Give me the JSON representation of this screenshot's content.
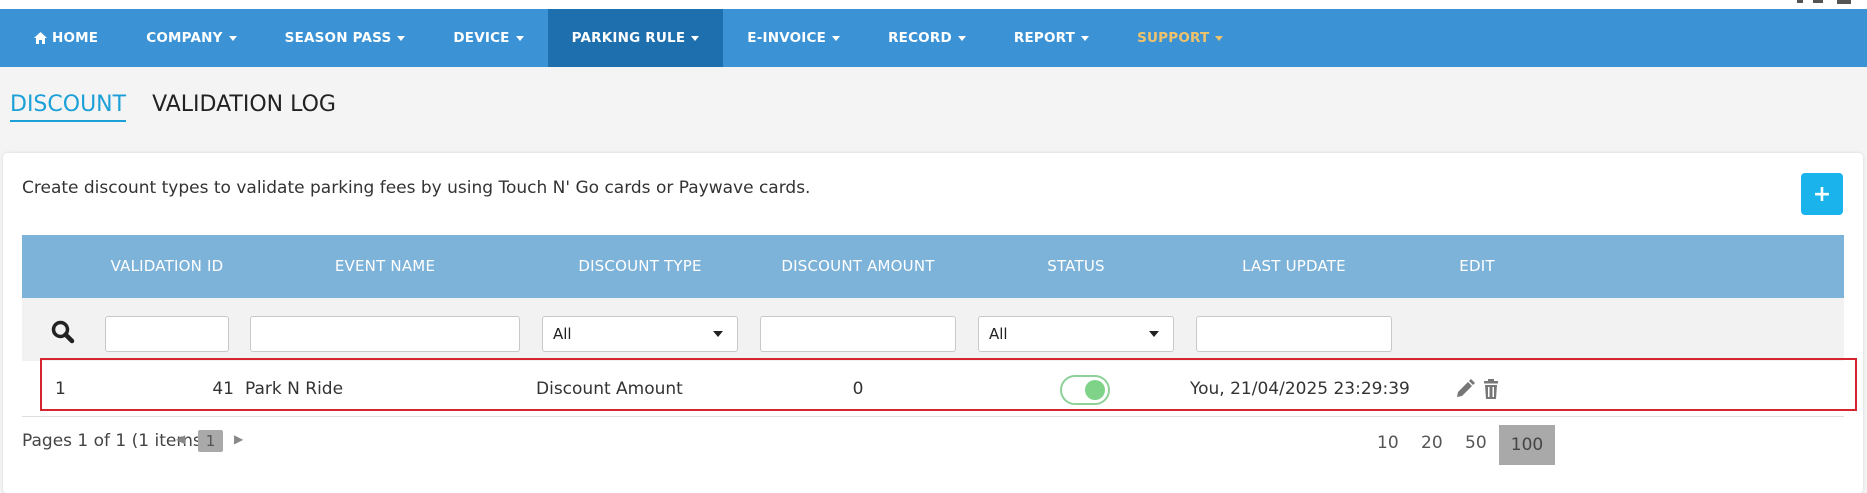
{
  "nav": {
    "items": [
      {
        "label": "HOME",
        "icon": "home-icon",
        "caret": false
      },
      {
        "label": "COMPANY",
        "caret": true
      },
      {
        "label": "SEASON PASS",
        "caret": true
      },
      {
        "label": "DEVICE",
        "caret": true
      },
      {
        "label": "PARKING RULE",
        "caret": true,
        "active": true
      },
      {
        "label": "E-INVOICE",
        "caret": true
      },
      {
        "label": "RECORD",
        "caret": true
      },
      {
        "label": "REPORT",
        "caret": true
      },
      {
        "label": "SUPPORT",
        "caret": true,
        "accent": "#f0c36b"
      }
    ],
    "background": "#3b93d6",
    "active_background": "#1e6fad"
  },
  "tabs": [
    {
      "label": "DISCOUNT",
      "active": true
    },
    {
      "label": "VALIDATION LOG",
      "active": false
    }
  ],
  "panel": {
    "description": "Create discount types to validate parking fees by using Touch N' Go cards or Paywave cards.",
    "add_button_label": "+"
  },
  "table": {
    "columns": [
      "VALIDATION ID",
      "EVENT NAME",
      "DISCOUNT TYPE",
      "DISCOUNT AMOUNT",
      "STATUS",
      "LAST UPDATE",
      "EDIT"
    ],
    "filters": {
      "discount_type_selected": "All",
      "status_selected": "All"
    },
    "rows": [
      {
        "row_number": "1",
        "validation_id": "41",
        "event_name": "Park N Ride",
        "discount_type": "Discount Amount",
        "discount_amount": "0",
        "status_on": true,
        "last_update": "You, 21/04/2025 23:29:39"
      }
    ]
  },
  "pager": {
    "summary": "Pages 1 of 1 (1 items)",
    "current_page": "1",
    "page_sizes": [
      "10",
      "20",
      "50",
      "100"
    ],
    "selected_page_size": "100"
  },
  "colors": {
    "accent": "#1ba0d8",
    "header": "#7eb3d9",
    "highlight_border": "#d5252f",
    "toggle_on": "#7ed389"
  }
}
